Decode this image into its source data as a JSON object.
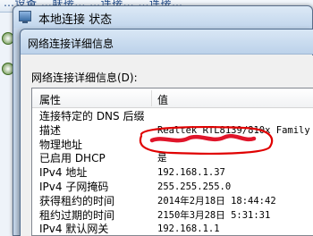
{
  "background": {
    "strip_text": "…设备 …联接…  …连接…          …连接…"
  },
  "status_window": {
    "title": "本地连接 状态"
  },
  "details_window": {
    "title": "网络连接详细信息",
    "section_label": "网络连接详细信息(D):",
    "columns": {
      "property": "属性",
      "value": "值"
    },
    "rows": [
      {
        "property": "连接特定的 DNS 后缀",
        "value": ""
      },
      {
        "property": "描述",
        "value": "Realtek RTL8139/810x Family"
      },
      {
        "property": "物理地址",
        "value": ""
      },
      {
        "property": "已启用 DHCP",
        "value": "是"
      },
      {
        "property": "IPv4 地址",
        "value": "192.168.1.37"
      },
      {
        "property": "IPv4 子网掩码",
        "value": "255.255.255.0"
      },
      {
        "property": "获得租约的时间",
        "value": "2014年2月18日 18:44:42"
      },
      {
        "property": "租约过期的时间",
        "value": "2150年3月28日 5:31:31"
      },
      {
        "property": "IPv4 默认网关",
        "value": "192.168.1.1"
      }
    ]
  },
  "colors": {
    "annotation": "#e00000",
    "redaction": "#e0152a"
  }
}
